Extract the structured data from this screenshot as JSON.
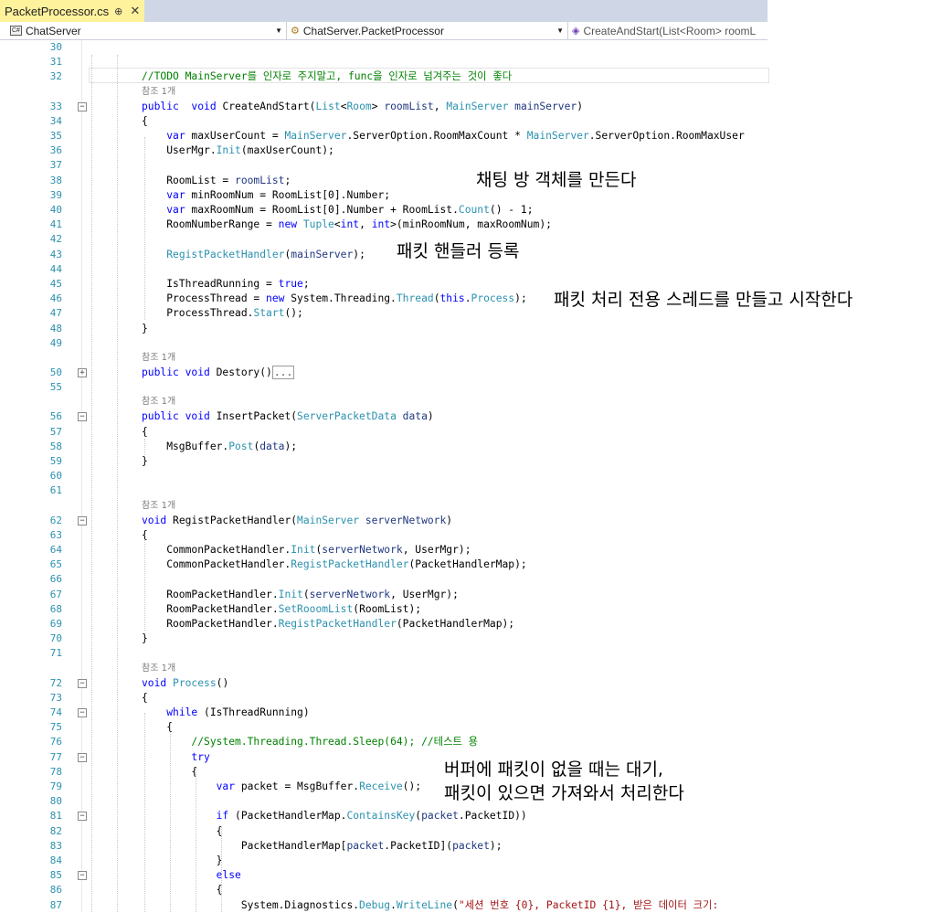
{
  "tab": {
    "filename": "PacketProcessor.cs",
    "pin": "⊕",
    "close": "✕"
  },
  "nav": {
    "project": "ChatServer",
    "class": "ChatServer.PacketProcessor",
    "member": "CreateAndStart(List<Room> roomL"
  },
  "ref_label": "참조 1개",
  "annotations": {
    "room_create": "채팅 방 객체를 만든다",
    "handler_register": "패킷 핸들러 등록",
    "thread_start": "패킷 처리 전용 스레드를 만들고 시작한다",
    "buffer_wait_1": "버퍼에 패킷이 없을 때는 대기,",
    "buffer_wait_2": "패킷이 있으면 가져와서 처리한다"
  },
  "colors": {
    "keyword": "#0000ff",
    "type": "#2b91af",
    "comment": "#008000",
    "string": "#a31515",
    "param": "#1f377f",
    "line_number": "#2b91af",
    "tab_active": "#fff29d"
  },
  "lines": [
    {
      "n": "30",
      "segs": []
    },
    {
      "n": "31",
      "segs": []
    },
    {
      "n": "32",
      "segs": [
        [
          "cm",
          "//TODO MainServer를 인자로 주지말고, func을 인자로 넘겨주는 것이 좋다"
        ]
      ]
    },
    {
      "n": "33",
      "ref": true,
      "fold": "−",
      "segs": [
        [
          "kw",
          "public"
        ],
        [
          "",
          "  "
        ],
        [
          "kw",
          "void"
        ],
        [
          "",
          " CreateAndStart("
        ],
        [
          "ty",
          "List"
        ],
        [
          "",
          "<"
        ],
        [
          "ty",
          "Room"
        ],
        [
          "",
          "> "
        ],
        [
          "par",
          "roomList"
        ],
        [
          "",
          ", "
        ],
        [
          "ty",
          "MainServer"
        ],
        [
          "par",
          " mainServer"
        ],
        [
          "",
          ")"
        ]
      ]
    },
    {
      "n": "34",
      "segs": [
        [
          "",
          "{"
        ]
      ]
    },
    {
      "n": "35",
      "segs": [
        [
          "",
          "    "
        ],
        [
          "kw",
          "var"
        ],
        [
          "",
          " maxUserCount = "
        ],
        [
          "ty",
          "MainServer"
        ],
        [
          "",
          ".ServerOption.RoomMaxCount * "
        ],
        [
          "ty",
          "MainServer"
        ],
        [
          "",
          ".ServerOption.RoomMaxUser"
        ]
      ]
    },
    {
      "n": "36",
      "segs": [
        [
          "",
          "    UserMgr."
        ],
        [
          "ty",
          "Init"
        ],
        [
          "",
          "(maxUserCount);"
        ]
      ]
    },
    {
      "n": "37",
      "segs": []
    },
    {
      "n": "38",
      "segs": [
        [
          "",
          "    RoomList = "
        ],
        [
          "par",
          "roomList"
        ],
        [
          "",
          ";"
        ]
      ]
    },
    {
      "n": "39",
      "segs": [
        [
          "",
          "    "
        ],
        [
          "kw",
          "var"
        ],
        [
          "",
          " minRoomNum = RoomList[0].Number;"
        ]
      ]
    },
    {
      "n": "40",
      "segs": [
        [
          "",
          "    "
        ],
        [
          "kw",
          "var"
        ],
        [
          "",
          " maxRoomNum = RoomList[0].Number + RoomList."
        ],
        [
          "ty",
          "Count"
        ],
        [
          "",
          "() - 1;"
        ]
      ]
    },
    {
      "n": "41",
      "segs": [
        [
          "",
          "    RoomNumberRange = "
        ],
        [
          "kw",
          "new"
        ],
        [
          "",
          ""
        ],
        [
          "ty",
          " Tuple"
        ],
        [
          "",
          "<"
        ],
        [
          "kw",
          "int"
        ],
        [
          "",
          ", "
        ],
        [
          "kw",
          "int"
        ],
        [
          "",
          ">(minRoomNum, maxRoomNum);"
        ]
      ]
    },
    {
      "n": "42",
      "segs": []
    },
    {
      "n": "43",
      "segs": [
        [
          "",
          "    "
        ],
        [
          "ty",
          "RegistPacketHandler"
        ],
        [
          "",
          "("
        ],
        [
          "par",
          "mainServer"
        ],
        [
          "",
          ");"
        ]
      ]
    },
    {
      "n": "44",
      "segs": []
    },
    {
      "n": "45",
      "segs": [
        [
          "",
          "    IsThreadRunning = "
        ],
        [
          "kw",
          "true"
        ],
        [
          "",
          ";"
        ]
      ]
    },
    {
      "n": "46",
      "segs": [
        [
          "",
          "    ProcessThread = "
        ],
        [
          "kw",
          "new"
        ],
        [
          "",
          " System.Threading."
        ],
        [
          "ty",
          "Thread"
        ],
        [
          "",
          "("
        ],
        [
          "kw",
          "this"
        ],
        [
          "",
          "."
        ],
        [
          "ty",
          "Process"
        ],
        [
          "",
          ");"
        ]
      ]
    },
    {
      "n": "47",
      "segs": [
        [
          "",
          "    ProcessThread."
        ],
        [
          "ty",
          "Start"
        ],
        [
          "",
          "();"
        ]
      ]
    },
    {
      "n": "48",
      "segs": [
        [
          "",
          "}"
        ]
      ]
    },
    {
      "n": "49",
      "segs": []
    },
    {
      "n": "50",
      "ref": true,
      "fold": "+",
      "segs": [
        [
          "kw",
          "public"
        ],
        [
          "",
          ""
        ],
        [
          "kw",
          " void"
        ],
        [
          "",
          " Destory()"
        ],
        [
          "box",
          "..."
        ]
      ]
    },
    {
      "n": "55",
      "segs": []
    },
    {
      "n": "56",
      "ref": true,
      "fold": "−",
      "segs": [
        [
          "kw",
          "public"
        ],
        [
          "kw",
          " void"
        ],
        [
          "",
          " InsertPacket("
        ],
        [
          "ty",
          "ServerPacketData"
        ],
        [
          "par",
          " data"
        ],
        [
          "",
          ")"
        ]
      ]
    },
    {
      "n": "57",
      "segs": [
        [
          "",
          "{"
        ]
      ]
    },
    {
      "n": "58",
      "segs": [
        [
          "",
          "    MsgBuffer."
        ],
        [
          "ty",
          "Post"
        ],
        [
          "",
          "("
        ],
        [
          "par",
          "data"
        ],
        [
          "",
          ");"
        ]
      ]
    },
    {
      "n": "59",
      "segs": [
        [
          "",
          "}"
        ]
      ]
    },
    {
      "n": "60",
      "segs": []
    },
    {
      "n": "61",
      "segs": []
    },
    {
      "n": "62",
      "ref": true,
      "fold": "−",
      "segs": [
        [
          "kw",
          "void"
        ],
        [
          "",
          " RegistPacketHandler("
        ],
        [
          "ty",
          "MainServer"
        ],
        [
          "par",
          " serverNetwork"
        ],
        [
          "",
          ")"
        ]
      ]
    },
    {
      "n": "63",
      "segs": [
        [
          "",
          "{"
        ]
      ]
    },
    {
      "n": "64",
      "segs": [
        [
          "",
          "    CommonPacketHandler."
        ],
        [
          "ty",
          "Init"
        ],
        [
          "",
          "("
        ],
        [
          "par",
          "serverNetwork"
        ],
        [
          "",
          ", UserMgr);"
        ]
      ]
    },
    {
      "n": "65",
      "segs": [
        [
          "",
          "    CommonPacketHandler."
        ],
        [
          "ty",
          "RegistPacketHandler"
        ],
        [
          "",
          "(PacketHandlerMap);"
        ]
      ]
    },
    {
      "n": "66",
      "segs": []
    },
    {
      "n": "67",
      "segs": [
        [
          "",
          "    RoomPacketHandler."
        ],
        [
          "ty",
          "Init"
        ],
        [
          "",
          "("
        ],
        [
          "par",
          "serverNetwork"
        ],
        [
          "",
          ", UserMgr);"
        ]
      ]
    },
    {
      "n": "68",
      "segs": [
        [
          "",
          "    RoomPacketHandler."
        ],
        [
          "ty",
          "SetRooomList"
        ],
        [
          "",
          "(RoomList);"
        ]
      ]
    },
    {
      "n": "69",
      "segs": [
        [
          "",
          "    RoomPacketHandler."
        ],
        [
          "ty",
          "RegistPacketHandler"
        ],
        [
          "",
          "(PacketHandlerMap);"
        ]
      ]
    },
    {
      "n": "70",
      "segs": [
        [
          "",
          "}"
        ]
      ]
    },
    {
      "n": "71",
      "segs": []
    },
    {
      "n": "72",
      "ref": true,
      "fold": "−",
      "segs": [
        [
          "kw",
          "void"
        ],
        [
          "",
          ""
        ],
        [
          "ty",
          " Process"
        ],
        [
          "",
          "()"
        ]
      ]
    },
    {
      "n": "73",
      "segs": [
        [
          "",
          "{"
        ]
      ]
    },
    {
      "n": "74",
      "fold": "−",
      "segs": [
        [
          "",
          "    "
        ],
        [
          "kw",
          "while"
        ],
        [
          "",
          " (IsThreadRunning)"
        ]
      ]
    },
    {
      "n": "75",
      "segs": [
        [
          "",
          "    {"
        ]
      ]
    },
    {
      "n": "76",
      "segs": [
        [
          "",
          "        "
        ],
        [
          "cm",
          "//System.Threading.Thread.Sleep(64); //테스트 용"
        ]
      ]
    },
    {
      "n": "77",
      "fold": "−",
      "segs": [
        [
          "",
          "        "
        ],
        [
          "kw",
          "try"
        ]
      ]
    },
    {
      "n": "78",
      "segs": [
        [
          "",
          "        {"
        ]
      ]
    },
    {
      "n": "79",
      "segs": [
        [
          "",
          "            "
        ],
        [
          "kw",
          "var"
        ],
        [
          "",
          " packet = MsgBuffer."
        ],
        [
          "ty",
          "Receive"
        ],
        [
          "",
          "();"
        ]
      ]
    },
    {
      "n": "80",
      "segs": []
    },
    {
      "n": "81",
      "fold": "−",
      "segs": [
        [
          "",
          "            "
        ],
        [
          "kw",
          "if"
        ],
        [
          "",
          " (PacketHandlerMap."
        ],
        [
          "ty",
          "ContainsKey"
        ],
        [
          "",
          "("
        ],
        [
          "par",
          "packet"
        ],
        [
          "",
          ".PacketID))"
        ]
      ]
    },
    {
      "n": "82",
      "segs": [
        [
          "",
          "            {"
        ]
      ]
    },
    {
      "n": "83",
      "segs": [
        [
          "",
          "                PacketHandlerMap["
        ],
        [
          "par",
          "packet"
        ],
        [
          "",
          ".PacketID]("
        ],
        [
          "par",
          "packet"
        ],
        [
          "",
          ");"
        ]
      ]
    },
    {
      "n": "84",
      "segs": [
        [
          "",
          "            }"
        ]
      ]
    },
    {
      "n": "85",
      "fold": "−",
      "segs": [
        [
          "",
          "            "
        ],
        [
          "kw",
          "else"
        ]
      ]
    },
    {
      "n": "86",
      "segs": [
        [
          "",
          "            {"
        ]
      ]
    },
    {
      "n": "87",
      "segs": [
        [
          "",
          "                System.Diagnostics."
        ],
        [
          "ty",
          "Debug"
        ],
        [
          "",
          "."
        ],
        [
          "ty",
          "WriteLine"
        ],
        [
          "",
          "("
        ],
        [
          "st",
          "\"세션 번호 {0}, PacketID {1}, 받은 데이터 크기:"
        ]
      ]
    }
  ]
}
